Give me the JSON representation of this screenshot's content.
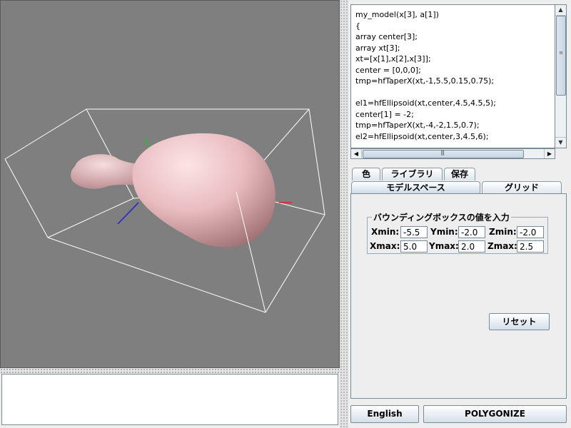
{
  "code": {
    "lines": [
      "my_model(x[3], a[1])",
      "{",
      "array center[3];",
      "array xt[3];",
      "xt=[x[1],x[2],x[3]];",
      "center = [0,0,0];",
      "tmp=hfTaperX(xt,-1,5.5,0.15,0.75);",
      "",
      "el1=hfEllipsoid(xt,center,4.5,4.5,5);",
      "center[1] = -2;",
      "tmp=hfTaperX(xt,-4,-2,1.5,0.7);",
      "el2=hfEllipsoid(xt,center,3,4.5,6);"
    ]
  },
  "tabs": {
    "color": "色",
    "library": "ライブラリ",
    "save": "保存",
    "model_space": "モデルスペース",
    "grid": "グリッド"
  },
  "bbox": {
    "title": "バウンディングボックスの値を入力",
    "xmin_label": "Xmin:",
    "xmin": "-5.5",
    "ymin_label": "Ymin:",
    "ymin": "-2.0",
    "zmin_label": "Zmin:",
    "zmin": "-2.0",
    "xmax_label": "Xmax:",
    "xmax": "5.0",
    "ymax_label": "Ymax:",
    "ymax": "2.0",
    "zmax_label": "Zmax:",
    "zmax": "2.5"
  },
  "buttons": {
    "reset": "リセット",
    "english": "English",
    "polygonize": "POLYGONIZE"
  },
  "console": {
    "text": ""
  },
  "colors": {
    "viewport_bg": "#7f7f7f",
    "model_fill": "#e8b8bc",
    "bbox_lines": "#ffffff",
    "axis_x": "#e02020",
    "axis_y": "#20c020",
    "axis_z": "#2020d0"
  },
  "icons": {
    "scroll_up": "arrow-up-icon",
    "scroll_down": "arrow-down-icon",
    "scroll_left": "arrow-left-icon",
    "scroll_right": "arrow-right-icon"
  }
}
